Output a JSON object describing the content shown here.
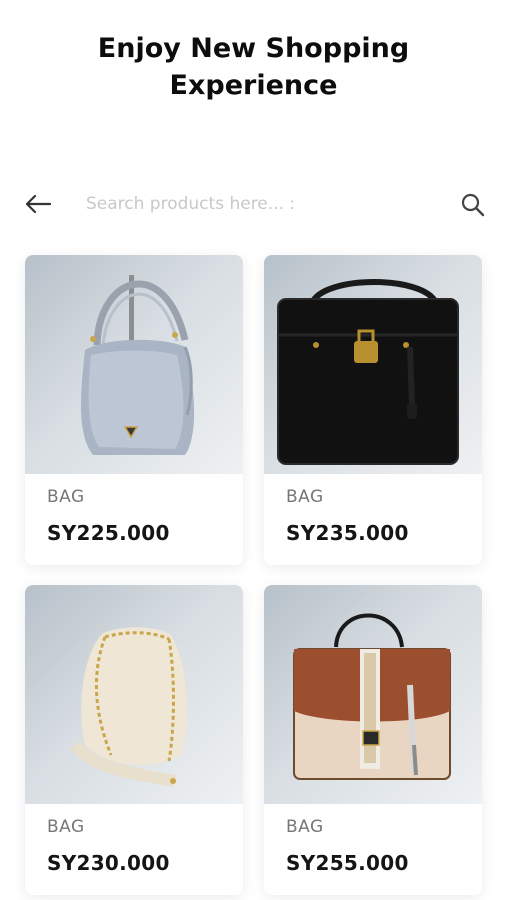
{
  "header": {
    "title_line1": "Enjoy New Shopping",
    "title_line2": "Experience"
  },
  "search": {
    "placeholder": "Search products here... :",
    "value": "",
    "back_icon": "arrow-left-icon",
    "search_icon": "magnifier-icon"
  },
  "products": [
    {
      "category": "BAG",
      "price": "SY225.000",
      "image": "gray-hobo-bag"
    },
    {
      "category": "BAG",
      "price": "SY235.000",
      "image": "black-handbag"
    },
    {
      "category": "BAG",
      "price": "SY230.000",
      "image": "cream-bucket-bag"
    },
    {
      "category": "BAG",
      "price": "SY255.000",
      "image": "brown-beige-satchel"
    }
  ],
  "colors": {
    "text": "#111111",
    "muted": "#777777",
    "placeholder": "#c8c8c8",
    "image_bg": "#d7dde2"
  }
}
